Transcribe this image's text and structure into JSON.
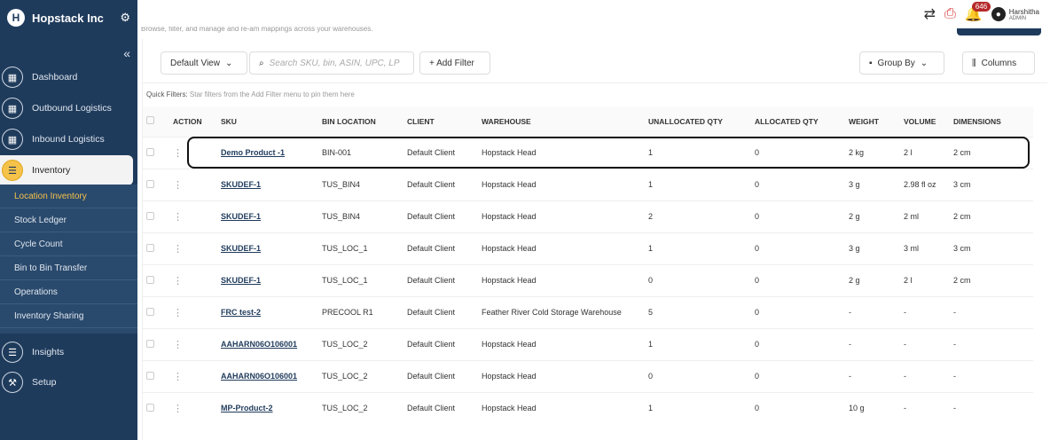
{
  "brand": {
    "name": "Hopstack Inc",
    "logo_letter": "H"
  },
  "sidebar": {
    "collapse_icon": "«",
    "items": [
      {
        "label": "Dashboard"
      },
      {
        "label": "Outbound Logistics"
      },
      {
        "label": "Inbound Logistics"
      },
      {
        "label": "Inventory"
      },
      {
        "label": "Insights"
      },
      {
        "label": "Setup"
      }
    ],
    "submenu": [
      {
        "label": "Location Inventory"
      },
      {
        "label": "Stock Ledger"
      },
      {
        "label": "Cycle Count"
      },
      {
        "label": "Bin to Bin Transfer"
      },
      {
        "label": "Operations"
      },
      {
        "label": "Inventory Sharing"
      }
    ]
  },
  "header": {
    "subtitle": "Browse, filter, and manage and re-am mappings across your warehouses.",
    "badge_count": "646",
    "user_name": "Harshitha",
    "user_role": "ADMIN"
  },
  "toolbar": {
    "view_label": "Default View",
    "search_placeholder": "Search SKU, bin, ASIN, UPC, LP",
    "add_filter_label": "+ Add Filter",
    "group_by_label": "Group By",
    "columns_label": "Columns"
  },
  "quick_filters": {
    "label": "Quick Filters:",
    "hint": "Star filters from the Add Filter menu to pin them here"
  },
  "table": {
    "headers": [
      "ACTION",
      "SKU",
      "BIN LOCATION",
      "CLIENT",
      "WAREHOUSE",
      "UNALLOCATED QTY",
      "ALLOCATED QTY",
      "WEIGHT",
      "VOLUME",
      "DIMENSIONS"
    ],
    "rows": [
      [
        "Demo Product -1",
        "BIN-001",
        "Default Client",
        "Hopstack Head",
        "1",
        "0",
        "2 kg",
        "2 l",
        "2 cm"
      ],
      [
        "SKUDEF-1",
        "TUS_BIN4",
        "Default Client",
        "Hopstack Head",
        "1",
        "0",
        "3 g",
        "2.98 fl oz",
        "3 cm"
      ],
      [
        "SKUDEF-1",
        "TUS_BIN4",
        "Default Client",
        "Hopstack Head",
        "2",
        "0",
        "2 g",
        "2 ml",
        "2 cm"
      ],
      [
        "SKUDEF-1",
        "TUS_LOC_1",
        "Default Client",
        "Hopstack Head",
        "1",
        "0",
        "3 g",
        "3 ml",
        "3 cm"
      ],
      [
        "SKUDEF-1",
        "TUS_LOC_1",
        "Default Client",
        "Hopstack Head",
        "0",
        "0",
        "2 g",
        "2 l",
        "2 cm"
      ],
      [
        "FRC test-2",
        "PRECOOL R1",
        "Default Client",
        "Feather River Cold Storage Warehouse",
        "5",
        "0",
        "-",
        "-",
        "-"
      ],
      [
        "AAHARN06O106001",
        "TUS_LOC_2",
        "Default Client",
        "Hopstack Head",
        "1",
        "0",
        "-",
        "-",
        "-"
      ],
      [
        "AAHARN06O106001",
        "TUS_LOC_2",
        "Default Client",
        "Hopstack Head",
        "0",
        "0",
        "-",
        "-",
        "-"
      ],
      [
        "MP-Product-2",
        "TUS_LOC_2",
        "Default Client",
        "Hopstack Head",
        "1",
        "0",
        "10 g",
        "-",
        "-"
      ]
    ]
  }
}
